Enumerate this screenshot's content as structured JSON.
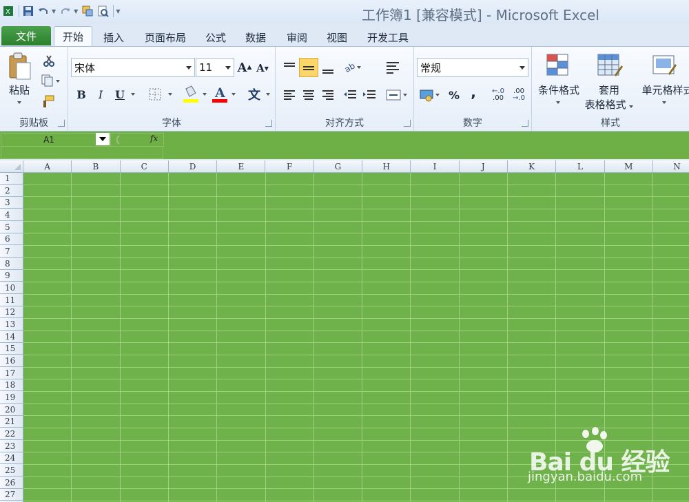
{
  "window": {
    "title": "工作簿1  [兼容模式]  -  Microsoft Excel"
  },
  "quick_access": [
    "excel-logo",
    "save",
    "undo",
    "redo",
    "copy-format",
    "print-preview",
    "customize"
  ],
  "tabs": {
    "file": "文件",
    "items": [
      "开始",
      "插入",
      "页面布局",
      "公式",
      "数据",
      "审阅",
      "视图",
      "开发工具"
    ],
    "active": "开始"
  },
  "ribbon": {
    "clipboard": {
      "label": "剪贴板",
      "paste": "粘贴"
    },
    "font": {
      "label": "字体",
      "font_name": "宋体",
      "font_size": "11",
      "bold": "B",
      "italic": "I",
      "underline": "U",
      "grow": "A",
      "shrink": "A",
      "phonetic": "文"
    },
    "alignment": {
      "label": "对齐方式"
    },
    "number": {
      "label": "数字",
      "format": "常规",
      "percent": "%",
      "comma": ",",
      "inc_decimal": ".00",
      "dec_decimal": ".00"
    },
    "styles": {
      "label": "样式",
      "conditional": "条件格式",
      "table_format_1": "套用",
      "table_format_2": "表格格式",
      "cell_styles": "单元格样式"
    }
  },
  "formula_bar": {
    "name_box": "A1",
    "fx": "fx"
  },
  "columns": [
    "A",
    "B",
    "C",
    "D",
    "E",
    "F",
    "G",
    "H",
    "I",
    "J",
    "K",
    "L",
    "M",
    "N"
  ],
  "rows": [
    "1",
    "2",
    "3",
    "4",
    "5",
    "6",
    "7",
    "8",
    "9",
    "10",
    "11",
    "12",
    "13",
    "14",
    "15",
    "16",
    "17",
    "18",
    "19",
    "20",
    "21",
    "22",
    "23",
    "24",
    "25",
    "26",
    "27"
  ],
  "colors": {
    "sheet_fill": "#6fb14a",
    "file_tab": "#2c7f2f"
  },
  "watermark": {
    "brand": "Bai du 经验",
    "url": "jingyan.baidu.com"
  }
}
